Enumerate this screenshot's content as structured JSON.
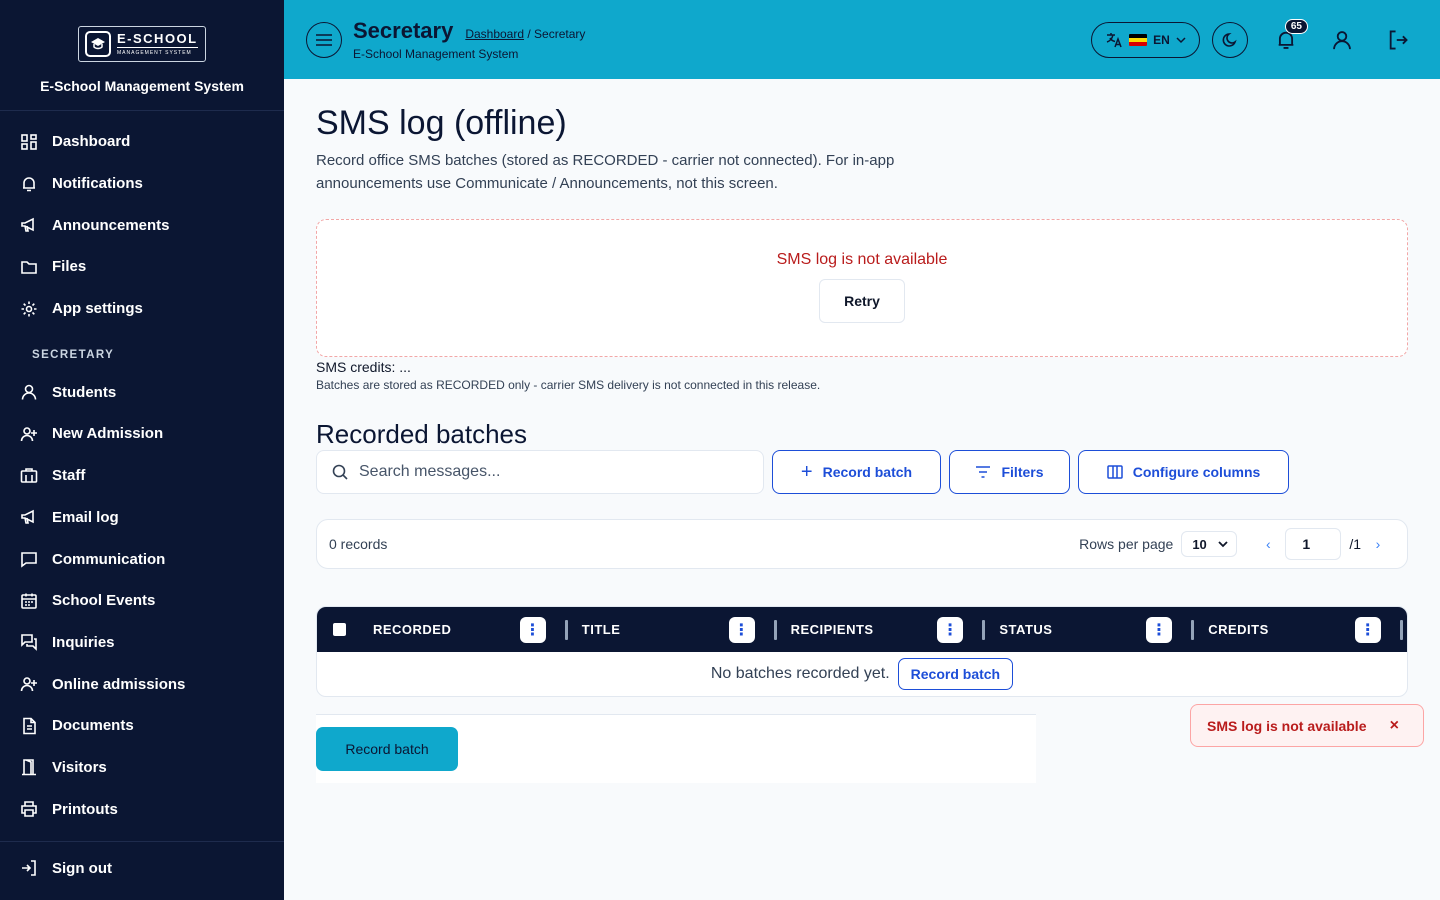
{
  "brand": {
    "logo_title": "E-SCHOOL",
    "logo_sub": "MANAGEMENT SYSTEM",
    "name": "E-School Management System"
  },
  "sidebar": {
    "items": [
      {
        "label": "Dashboard",
        "icon": "dashboard-grid-icon"
      },
      {
        "label": "Notifications",
        "icon": "bell-icon"
      },
      {
        "label": "Announcements",
        "icon": "megaphone-icon"
      },
      {
        "label": "Files",
        "icon": "folder-icon"
      },
      {
        "label": "App settings",
        "icon": "gear-icon"
      }
    ],
    "section": "SECRETARY",
    "section_items": [
      {
        "label": "Students",
        "icon": "user-icon"
      },
      {
        "label": "New Admission",
        "icon": "user-plus-icon"
      },
      {
        "label": "Staff",
        "icon": "id-card-icon"
      },
      {
        "label": "Email log",
        "icon": "megaphone-icon"
      },
      {
        "label": "Communication",
        "icon": "chat-icon"
      },
      {
        "label": "School Events",
        "icon": "calendar-icon"
      },
      {
        "label": "Inquiries",
        "icon": "chat-bubbles-icon"
      },
      {
        "label": "Online admissions",
        "icon": "user-plus-icon"
      },
      {
        "label": "Documents",
        "icon": "document-icon"
      },
      {
        "label": "Visitors",
        "icon": "door-icon"
      },
      {
        "label": "Printouts",
        "icon": "printer-icon"
      }
    ],
    "signout": "Sign out"
  },
  "header": {
    "title": "Secretary",
    "crumb_link": "Dashboard",
    "crumb_current": " / Secretary",
    "subtitle": "E-School Management System",
    "lang": "EN",
    "notif_count": "65"
  },
  "main": {
    "title": "SMS log (offline)",
    "description": "Record office SMS batches (stored as RECORDED - carrier not connected). For in-app announcements use Communicate / Announcements, not this screen.",
    "error_msg": "SMS log is not available",
    "retry": "Retry",
    "credits": "SMS credits: ...",
    "credits_note": "Batches are stored as RECORDED only - carrier SMS delivery is not connected in this release.",
    "section_title": "Recorded batches",
    "search_placeholder": "Search messages...",
    "record_batch": "Record batch",
    "filters": "Filters",
    "configure_columns": "Configure columns",
    "records": "0 records",
    "rows_per_page_label": "Rows per page",
    "rows_per_page": "10",
    "page": "1",
    "page_total": "/1",
    "columns": [
      "RECORDED",
      "TITLE",
      "RECIPIENTS",
      "STATUS",
      "CREDITS"
    ],
    "empty": "No batches recorded yet.",
    "empty_btn": "Record batch",
    "footer_btn": "Record batch"
  },
  "toast": {
    "message": "SMS log is not available",
    "close": "×"
  }
}
